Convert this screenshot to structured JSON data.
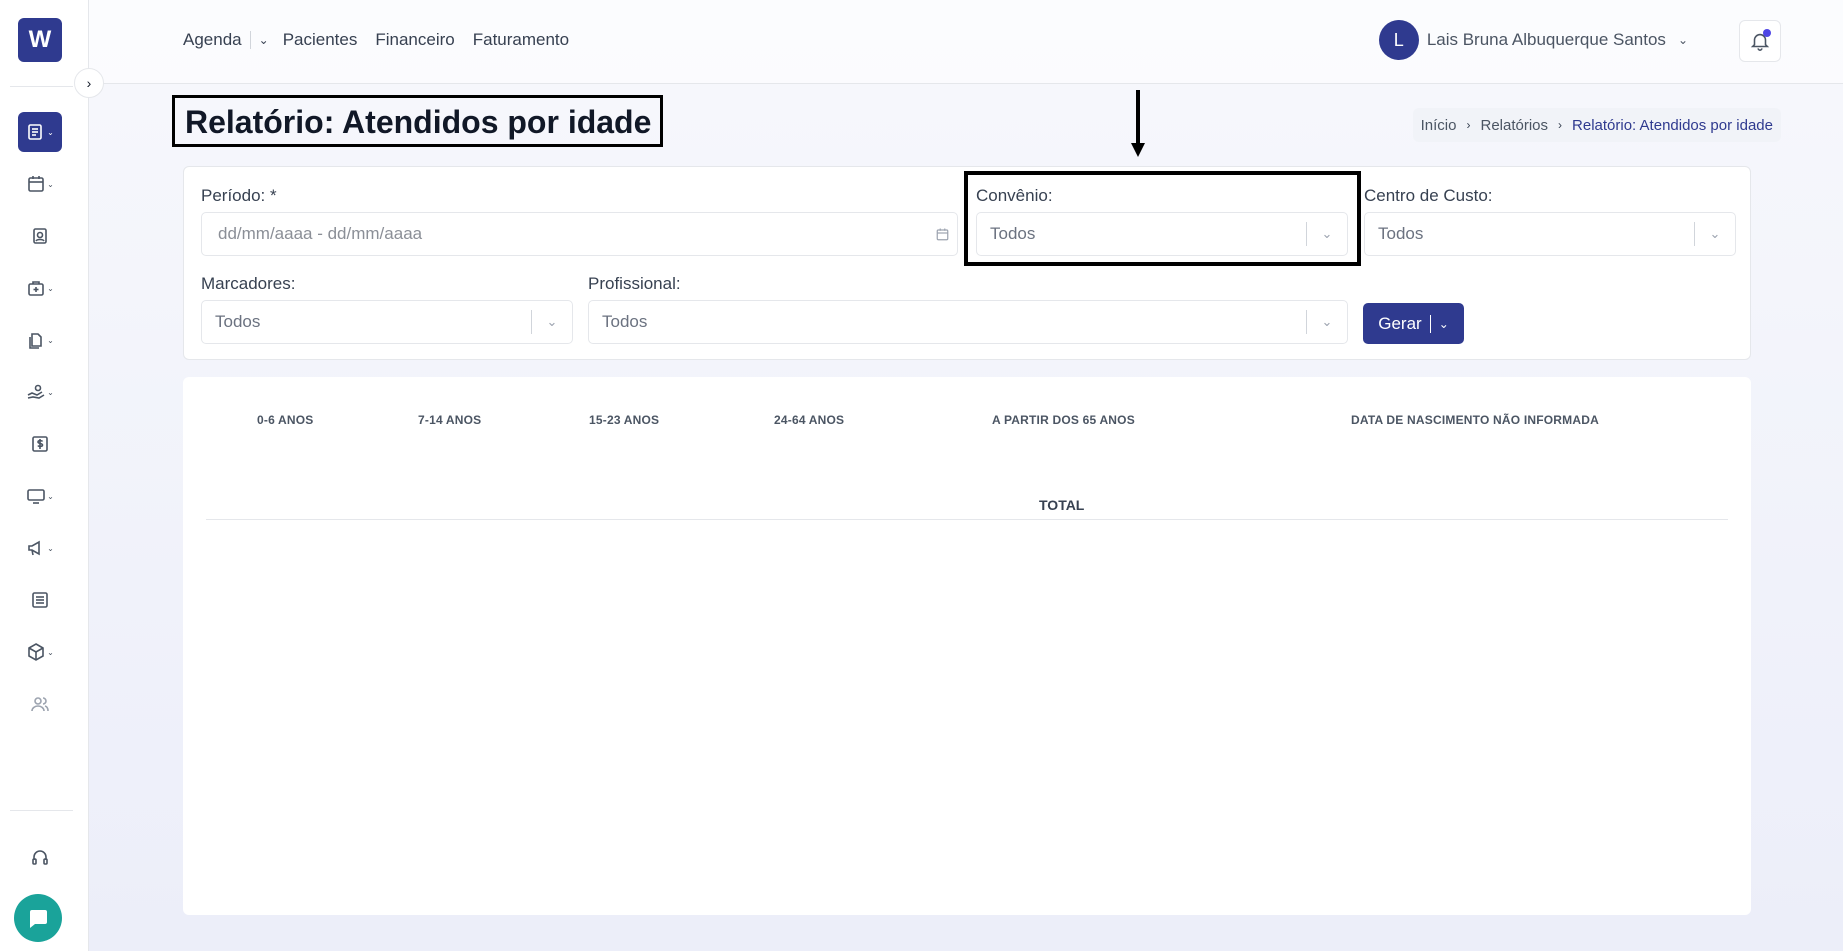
{
  "brand": {
    "logo_letter": "W",
    "accent": "#2f3a8f"
  },
  "sidebar": {
    "items": [
      {
        "name": "reports",
        "icon": "report-icon",
        "active": true
      },
      {
        "name": "calendar",
        "icon": "calendar-icon"
      },
      {
        "name": "patients",
        "icon": "patient-card-icon"
      },
      {
        "name": "clinic",
        "icon": "medical-bag-icon"
      },
      {
        "name": "documents",
        "icon": "documents-icon"
      },
      {
        "name": "care",
        "icon": "hand-care-icon"
      },
      {
        "name": "finance",
        "icon": "dollar-icon"
      },
      {
        "name": "screen",
        "icon": "monitor-icon"
      },
      {
        "name": "marketing",
        "icon": "megaphone-icon"
      },
      {
        "name": "news",
        "icon": "newspaper-icon"
      },
      {
        "name": "inventory",
        "icon": "box-icon"
      },
      {
        "name": "users",
        "icon": "users-icon"
      }
    ],
    "support_icon": "headset-icon",
    "chat_icon": "chat-icon"
  },
  "topnav": {
    "agenda": "Agenda",
    "pacientes": "Pacientes",
    "financeiro": "Financeiro",
    "faturamento": "Faturamento"
  },
  "user": {
    "initial": "L",
    "name": "Lais Bruna Albuquerque Santos"
  },
  "page": {
    "title": "Relatório: Atendidos por idade"
  },
  "breadcrumb": {
    "home": "Início",
    "reports": "Relatórios",
    "current": "Relatório: Atendidos por idade"
  },
  "filters": {
    "periodo_label": "Período: *",
    "periodo_placeholder": "dd/mm/aaaa - dd/mm/aaaa",
    "convenio_label": "Convênio:",
    "convenio_value": "Todos",
    "centro_label": "Centro de Custo:",
    "centro_value": "Todos",
    "marcadores_label": "Marcadores:",
    "marcadores_value": "Todos",
    "profissional_label": "Profissional:",
    "profissional_value": "Todos",
    "gerar_label": "Gerar"
  },
  "table": {
    "columns": [
      "0-6 ANOS",
      "7-14 ANOS",
      "15-23 ANOS",
      "24-64 ANOS",
      "A PARTIR DOS 65 ANOS",
      "DATA DE NASCIMENTO NÃO INFORMADA"
    ],
    "total_label": "TOTAL"
  }
}
